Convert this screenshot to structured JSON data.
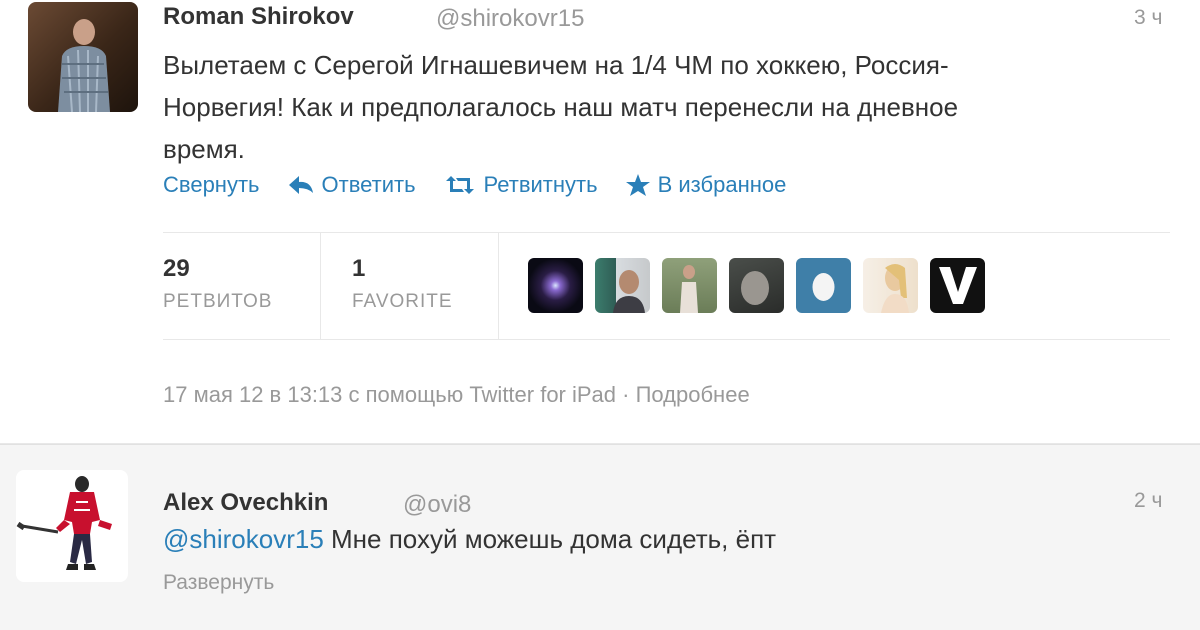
{
  "tweets": [
    {
      "name": "Roman Shirokov",
      "handle": "@shirokovr15",
      "time": "3 ч",
      "text_lines": [
        "Вылетаем с Серегой Игнашевичем на 1/4 ЧМ по хоккею, Россия-",
        "Норвегия! Как и предполагалось наш матч перенесли на дневное",
        "время."
      ],
      "actions": {
        "collapse": "Свернуть",
        "reply": "Ответить",
        "retweet": "Ретвитнуть",
        "favorite": "В избранное"
      },
      "stats": {
        "retweets_count": "29",
        "retweets_label": "РЕТВИТОВ",
        "favorites_count": "1",
        "favorites_label": "FAVORITE"
      },
      "meta": "17 мая 12 в 13:13 с помощью Twitter for iPad · Подробнее"
    },
    {
      "name": "Alex Ovechkin",
      "handle": "@ovi8",
      "time": "2 ч",
      "mention": "@shirokovr15",
      "text": " Мне похуй можешь дома сидеть, ёпт",
      "expand": "Развернуть"
    }
  ],
  "colors": {
    "link": "#2a7fb8",
    "muted": "#999999",
    "text": "#333333",
    "reply_bg": "#f5f5f5"
  },
  "icons": {
    "reply": "reply-arrow-icon",
    "retweet": "retweet-icon",
    "favorite": "star-icon"
  }
}
